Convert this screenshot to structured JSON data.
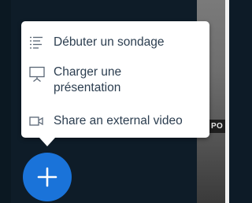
{
  "actions_menu": {
    "items": [
      {
        "label": "Débuter un sondage",
        "icon": "poll-icon"
      },
      {
        "label": "Charger une présentation",
        "icon": "presentation-icon"
      },
      {
        "label": "Share an external video",
        "icon": "video-icon"
      }
    ]
  },
  "background": {
    "video_label": "PO"
  },
  "actions_button": {
    "icon": "plus-icon",
    "color": "#1a73d9"
  },
  "colors": {
    "menu_text": "#2c3e50",
    "icon_stroke": "#5a6675",
    "background_dark": "#0e1c28"
  }
}
